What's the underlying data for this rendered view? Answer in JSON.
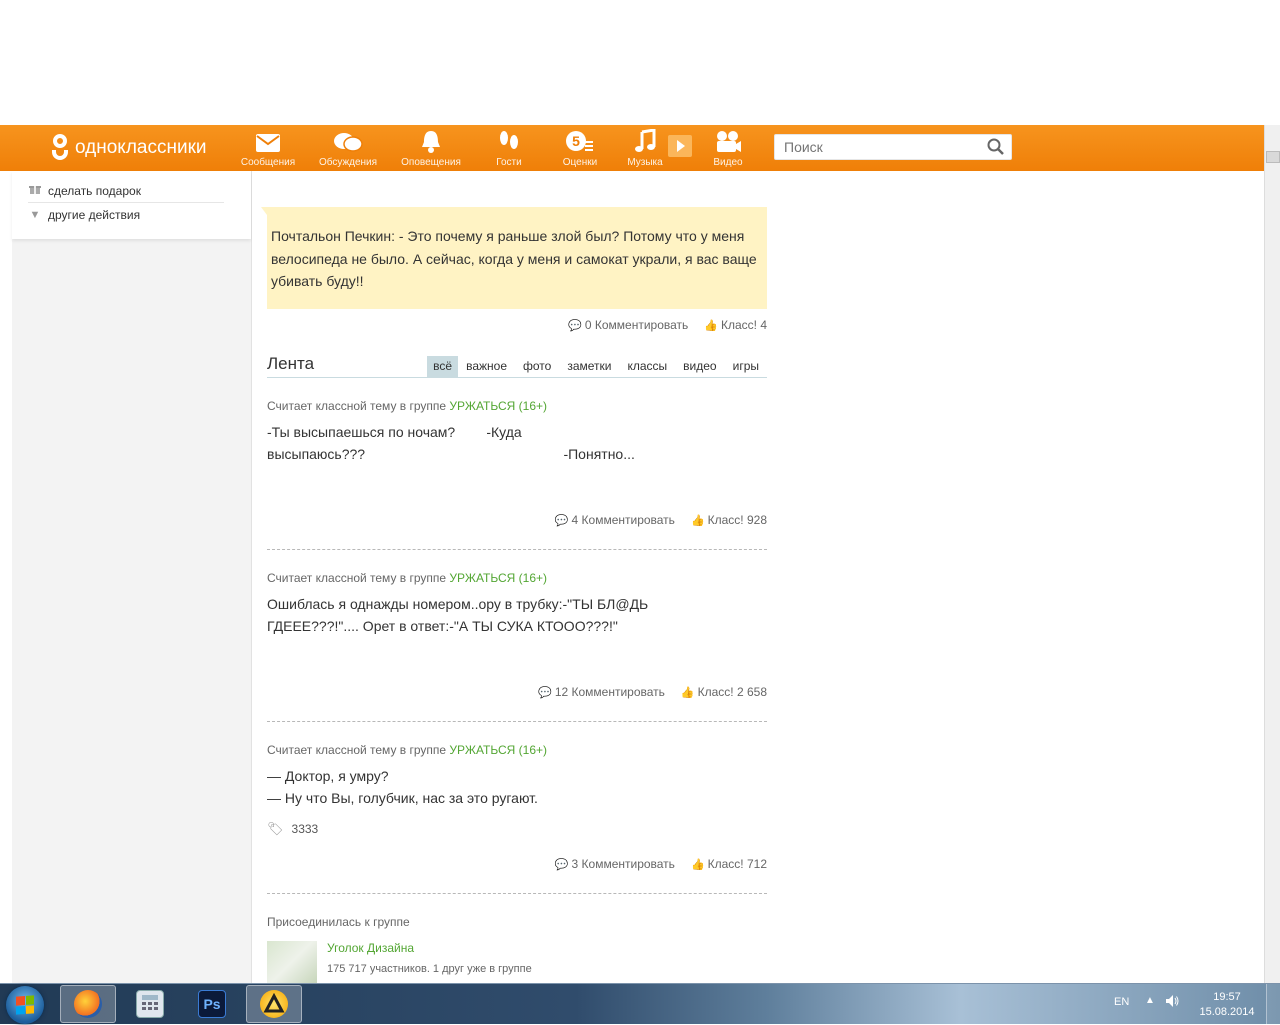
{
  "header": {
    "logo_text": "одноклассники",
    "nav": [
      {
        "label": "Сообщения",
        "icon": "envelope-icon"
      },
      {
        "label": "Обсуждения",
        "icon": "speech-bubbles-icon"
      },
      {
        "label": "Оповещения",
        "icon": "bell-icon"
      },
      {
        "label": "Гости",
        "icon": "footprints-icon"
      },
      {
        "label": "Оценки",
        "icon": "rating-5-icon",
        "glyph": "5"
      },
      {
        "label": "Музыка",
        "icon": "music-note-icon"
      },
      {
        "label": "Видео",
        "icon": "video-camera-icon"
      }
    ],
    "search_placeholder": "Поиск"
  },
  "left_menu": {
    "items": [
      {
        "label": "сделать подарок",
        "icon": "gift-icon"
      },
      {
        "label": "другие действия",
        "icon": "triangle-down-icon"
      }
    ]
  },
  "quote": {
    "text": "Почтальон Печкин: - Это почему я раньше злой был? Потому что у меня велосипеда не было. А сейчас, когда у меня и самокат украли, я вас ваще убивать буду!!",
    "comments": "0 Комментировать",
    "likes": "Класс! 4"
  },
  "feed": {
    "title": "Лента",
    "tabs": [
      "всё",
      "важное",
      "фото",
      "заметки",
      "классы",
      "видео",
      "игры"
    ],
    "active_tab": "всё",
    "posts": [
      {
        "prefix": "Считает классной тему в группе",
        "group": "УРЖАТЬСЯ (16+)",
        "text": "-Ты высыпаешься по ночам?        -Куда\nвысыпаюсь???                                                   -Понятно...",
        "comments": "4 Комментировать",
        "likes": "Класс! 928"
      },
      {
        "prefix": "Считает классной тему в группе",
        "group": "УРЖАТЬСЯ (16+)",
        "text": "Ошиблась я однажды номером..ору в трубку:-\"ТЫ БЛ@ДЬ\nГДЕЕЕ???!\".... Орет в ответ:-\"А ТЫ СУКА КТОOO???!\"",
        "comments": "12 Комментировать",
        "likes": "Класс! 2 658"
      },
      {
        "prefix": "Считает классной тему в группе",
        "group": "УРЖАТЬСЯ (16+)",
        "text": "— Доктор, я умру?\n— Ну что Вы, голубчик, нас за это ругают.",
        "tag": "3333",
        "comments": "3 Комментировать",
        "likes": "Класс! 712"
      }
    ],
    "joined": {
      "label": "Присоединилась к группе",
      "group_name": "Уголок Дизайна",
      "group_info": "175 717 участников. 1 друг уже в группе"
    }
  },
  "taskbar": {
    "apps": [
      "firefox-icon",
      "calculator-icon",
      "photoshop-icon",
      "aimp-icon"
    ],
    "photoshop_label": "Ps",
    "lang": "EN",
    "time": "19:57",
    "date": "15.08.2014"
  },
  "colors": {
    "accent": "#f7941e",
    "link_green": "#53a633",
    "quote_bg": "#fff3c4"
  }
}
